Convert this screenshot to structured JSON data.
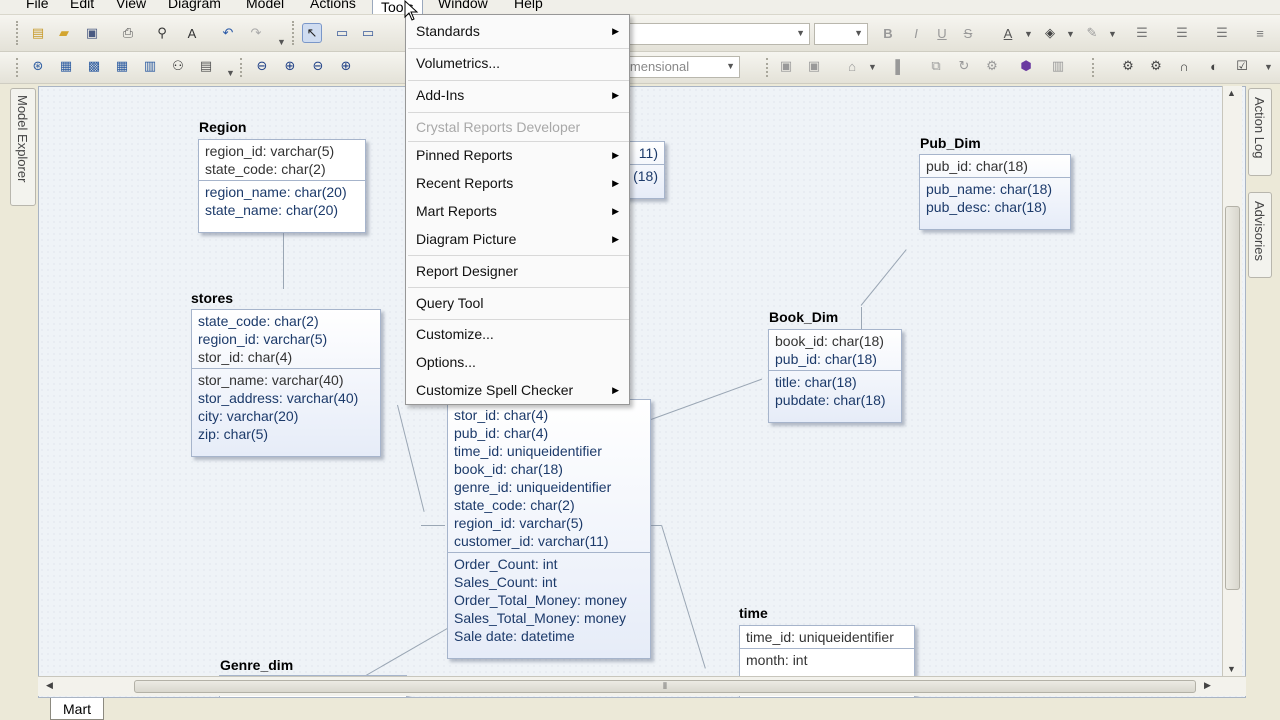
{
  "menubar": {
    "items": [
      "File",
      "Edit",
      "View",
      "Diagram",
      "Model",
      "Actions",
      "Tools",
      "Window",
      "Help"
    ]
  },
  "toolbar": {
    "notation_combo": "imensional"
  },
  "side_tabs": {
    "left": "Model Explorer",
    "right_top": "Action Log",
    "right_bottom": "Advisories"
  },
  "tools_menu": {
    "items": [
      {
        "label": "Standards",
        "submenu": true,
        "enabled": true
      },
      {
        "label": "Volumetrics...",
        "submenu": false,
        "enabled": true
      },
      {
        "label": "Add-Ins",
        "submenu": true,
        "enabled": true
      },
      {
        "label": "Crystal Reports Developer",
        "submenu": false,
        "enabled": false
      },
      {
        "label": "Pinned Reports",
        "submenu": true,
        "enabled": true
      },
      {
        "label": "Recent Reports",
        "submenu": true,
        "enabled": true
      },
      {
        "label": "Mart Reports",
        "submenu": true,
        "enabled": true
      },
      {
        "label": "Diagram Picture",
        "submenu": true,
        "enabled": true
      },
      {
        "label": "Report Designer",
        "submenu": false,
        "enabled": true
      },
      {
        "label": "Query Tool",
        "submenu": false,
        "enabled": true
      },
      {
        "label": "Customize...",
        "submenu": false,
        "enabled": true
      },
      {
        "label": "Options...",
        "submenu": false,
        "enabled": true
      },
      {
        "label": "Customize Spell Checker",
        "submenu": true,
        "enabled": true
      }
    ]
  },
  "entities": {
    "region": {
      "name": "Region",
      "keys": [
        "region_id: varchar(5)",
        "state_code: char(2)"
      ],
      "attrs": [
        "region_name: char(20)",
        "state_name: char(20)"
      ]
    },
    "hidden_entity": {
      "keys": [
        "11)"
      ],
      "attrs": [
        "(18)"
      ]
    },
    "pub_dim": {
      "name": "Pub_Dim",
      "keys": [
        "pub_id: char(18)"
      ],
      "attrs": [
        "pub_name: char(18)",
        "pub_desc: char(18)"
      ]
    },
    "stores": {
      "name": "stores",
      "keys": [
        "state_code: char(2)",
        "region_id: varchar(5)",
        "stor_id: char(4)"
      ],
      "attrs": [
        "stor_name: varchar(40)",
        "stor_address: varchar(40)",
        "city: varchar(20)",
        "zip: char(5)"
      ]
    },
    "book_dim": {
      "name": "Book_Dim",
      "keys": [
        "book_id: char(18)",
        "pub_id: char(18)"
      ],
      "attrs": [
        "title: char(18)",
        "pubdate: char(18)"
      ]
    },
    "sales_fact": {
      "keys": [
        "stor_id: char(4)",
        "pub_id: char(4)",
        "time_id: uniqueidentifier",
        "book_id: char(18)",
        "genre_id: uniqueidentifier",
        "state_code: char(2)",
        "region_id: varchar(5)",
        "customer_id: varchar(11)"
      ],
      "attrs": [
        "Order_Count: int",
        "Sales_Count: int",
        "Order_Total_Money: money",
        "Sales_Total_Money: money",
        "Sale  date: datetime"
      ]
    },
    "time": {
      "name": "time",
      "keys": [
        "time_id: uniqueidentifier"
      ],
      "attrs": [
        "month: int"
      ]
    },
    "genre_dim": {
      "name": "Genre_dim"
    }
  },
  "bottom_tab": "Mart"
}
